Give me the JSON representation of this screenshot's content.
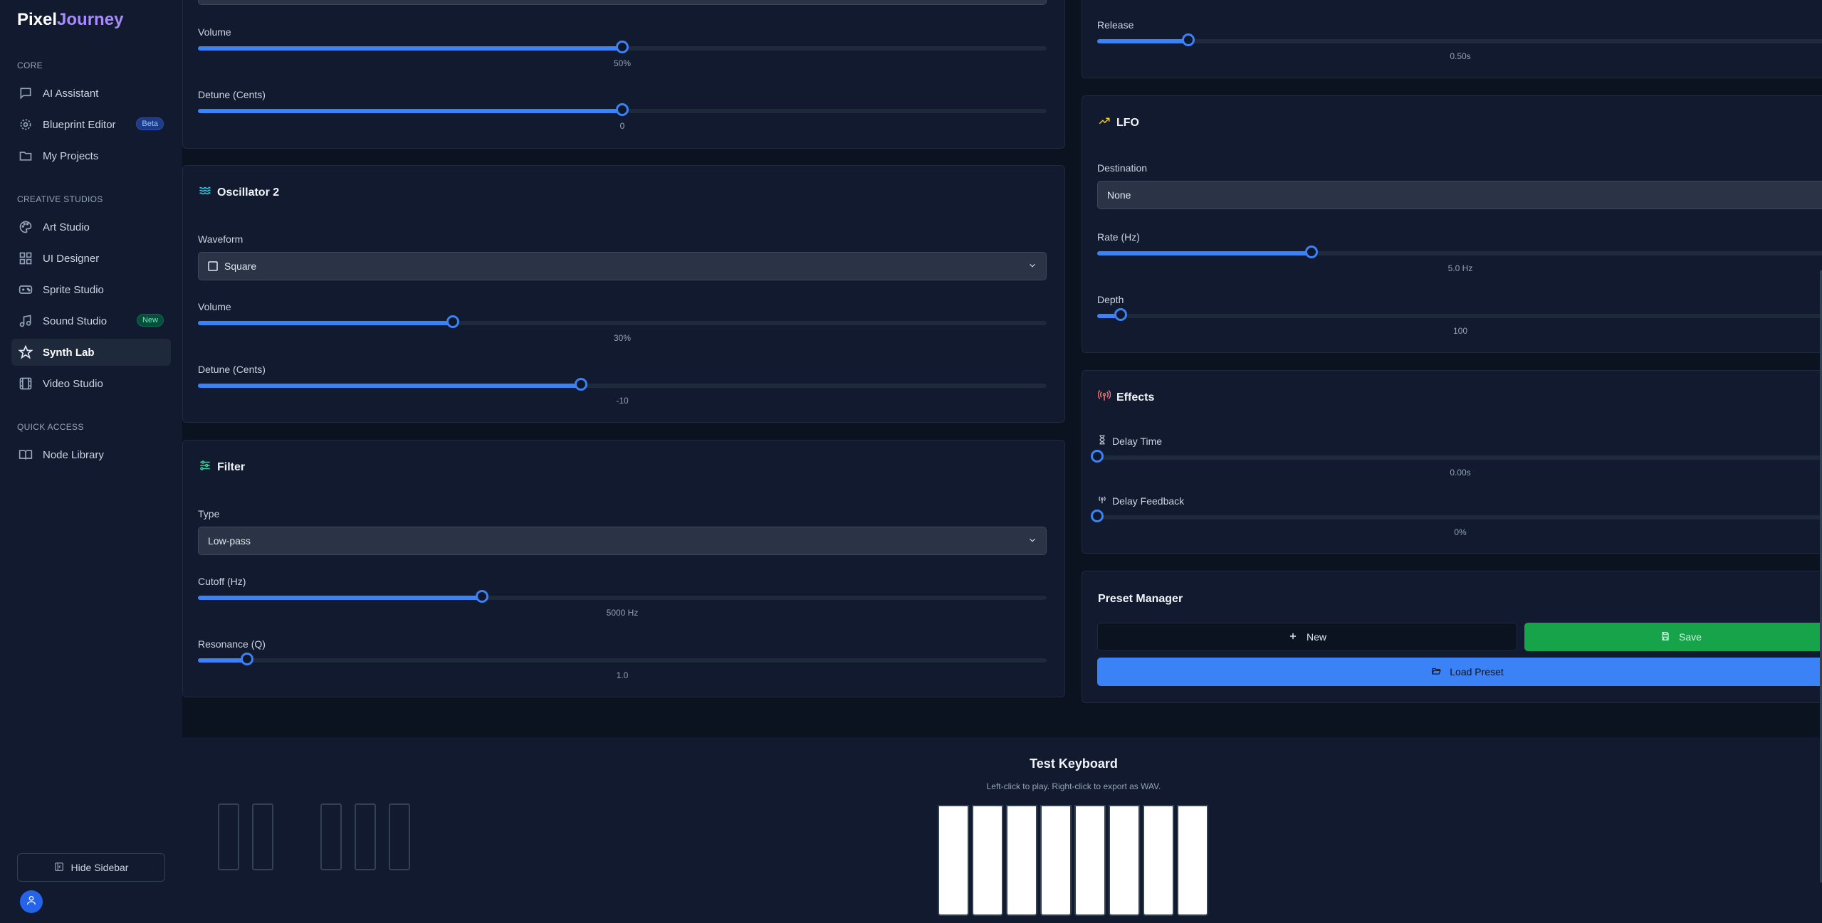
{
  "brand": {
    "part1": "Pixel",
    "part2": "Journey"
  },
  "sidebar": {
    "sections": {
      "core": "CORE",
      "creative": "CREATIVE STUDIOS",
      "quick": "QUICK ACCESS"
    },
    "items": [
      {
        "label": "AI Assistant"
      },
      {
        "label": "Blueprint Editor",
        "badge": "Beta"
      },
      {
        "label": "My Projects"
      },
      {
        "label": "Art Studio"
      },
      {
        "label": "UI Designer"
      },
      {
        "label": "Sprite Studio"
      },
      {
        "label": "Sound Studio",
        "badge": "New"
      },
      {
        "label": "Synth Lab"
      },
      {
        "label": "Video Studio"
      },
      {
        "label": "Node Library"
      }
    ],
    "active_item": "Synth Lab",
    "hide_label": "Hide Sidebar"
  },
  "osc1": {
    "volume": {
      "label": "Volume",
      "value_text": "50%",
      "level": 0.5
    },
    "detune": {
      "label": "Detune (Cents)",
      "value_text": "0",
      "level": 0.5
    }
  },
  "osc2": {
    "title": "Oscillator 2",
    "waveform_label": "Waveform",
    "waveform_value": "Square",
    "volume": {
      "label": "Volume",
      "value_text": "30%",
      "level": 0.3
    },
    "detune": {
      "label": "Detune (Cents)",
      "value_text": "-10",
      "level": 0.451
    }
  },
  "filter": {
    "title": "Filter",
    "type_label": "Type",
    "type_value": "Low-pass",
    "cutoff": {
      "label": "Cutoff (Hz)",
      "value_text": "5000 Hz",
      "level": 0.335
    },
    "resonance": {
      "label": "Resonance (Q)",
      "value_text": "1.0",
      "level": 0.058
    }
  },
  "envelope": {
    "release": {
      "label": "Release",
      "value_text": "0.50s",
      "level": 0.125
    }
  },
  "lfo": {
    "title": "LFO",
    "destination_label": "Destination",
    "destination_value": "None",
    "rate": {
      "label": "Rate (Hz)",
      "value_text": "5.0 Hz",
      "level": 0.295
    },
    "depth": {
      "label": "Depth",
      "value_text": "100",
      "level": 0.032
    }
  },
  "effects": {
    "title": "Effects",
    "delay_time": {
      "label": "Delay Time",
      "value_text": "0.00s",
      "level": 0.0
    },
    "delay_feedback": {
      "label": "Delay Feedback",
      "value_text": "0%",
      "level": 0.0
    }
  },
  "presets": {
    "title": "Preset Manager",
    "new_label": "New",
    "save_label": "Save",
    "load_label": "Load Preset"
  },
  "keyboard": {
    "title": "Test Keyboard",
    "hint": "Left-click to play. Right-click to export as WAV."
  },
  "colors": {
    "accent": "#3b82f6",
    "save_green": "#16a34a",
    "brand_purple": "#a78bfa",
    "lfo_icon": "#facc15",
    "effects_icon": "#f87171",
    "filter_icon": "#34d399",
    "osc_icon": "#22d3ee"
  }
}
